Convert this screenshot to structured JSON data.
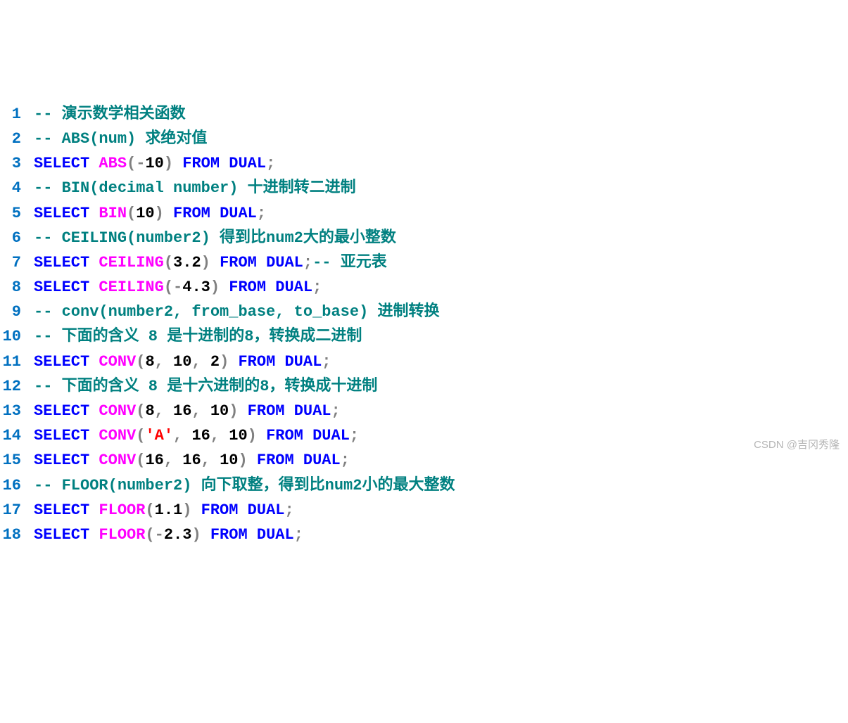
{
  "watermark": "CSDN @吉冈秀隆",
  "lines": [
    {
      "n": "1",
      "tokens": [
        {
          "c": "comment",
          "t": "-- 演示数学相关函数"
        }
      ]
    },
    {
      "n": "2",
      "tokens": [
        {
          "c": "comment",
          "t": "-- ABS(num) 求绝对值"
        }
      ]
    },
    {
      "n": "3",
      "tokens": [
        {
          "c": "keyword",
          "t": "SELECT"
        },
        {
          "c": "",
          "t": " "
        },
        {
          "c": "func",
          "t": "ABS"
        },
        {
          "c": "sym",
          "t": "("
        },
        {
          "c": "sym",
          "t": "-"
        },
        {
          "c": "num",
          "t": "10"
        },
        {
          "c": "sym",
          "t": ")"
        },
        {
          "c": "",
          "t": " "
        },
        {
          "c": "keyword",
          "t": "FROM"
        },
        {
          "c": "",
          "t": " "
        },
        {
          "c": "keyword",
          "t": "DUAL"
        },
        {
          "c": "sym",
          "t": ";"
        }
      ]
    },
    {
      "n": "4",
      "tokens": [
        {
          "c": "comment",
          "t": "-- BIN(decimal number) 十进制转二进制"
        }
      ]
    },
    {
      "n": "5",
      "tokens": [
        {
          "c": "keyword",
          "t": "SELECT"
        },
        {
          "c": "",
          "t": " "
        },
        {
          "c": "func",
          "t": "BIN"
        },
        {
          "c": "sym",
          "t": "("
        },
        {
          "c": "num",
          "t": "10"
        },
        {
          "c": "sym",
          "t": ")"
        },
        {
          "c": "",
          "t": " "
        },
        {
          "c": "keyword",
          "t": "FROM"
        },
        {
          "c": "",
          "t": " "
        },
        {
          "c": "keyword",
          "t": "DUAL"
        },
        {
          "c": "sym",
          "t": ";"
        }
      ]
    },
    {
      "n": "6",
      "tokens": [
        {
          "c": "comment",
          "t": "-- CEILING(number2) 得到比num2大的最小整数"
        }
      ]
    },
    {
      "n": "7",
      "tokens": [
        {
          "c": "keyword",
          "t": "SELECT"
        },
        {
          "c": "",
          "t": " "
        },
        {
          "c": "func",
          "t": "CEILING"
        },
        {
          "c": "sym",
          "t": "("
        },
        {
          "c": "num",
          "t": "3.2"
        },
        {
          "c": "sym",
          "t": ")"
        },
        {
          "c": "",
          "t": " "
        },
        {
          "c": "keyword",
          "t": "FROM"
        },
        {
          "c": "",
          "t": " "
        },
        {
          "c": "keyword",
          "t": "DUAL"
        },
        {
          "c": "sym",
          "t": ";"
        },
        {
          "c": "comment",
          "t": "-- 亚元表"
        }
      ]
    },
    {
      "n": "8",
      "tokens": [
        {
          "c": "keyword",
          "t": "SELECT"
        },
        {
          "c": "",
          "t": " "
        },
        {
          "c": "func",
          "t": "CEILING"
        },
        {
          "c": "sym",
          "t": "("
        },
        {
          "c": "sym",
          "t": "-"
        },
        {
          "c": "num",
          "t": "4.3"
        },
        {
          "c": "sym",
          "t": ")"
        },
        {
          "c": "",
          "t": " "
        },
        {
          "c": "keyword",
          "t": "FROM"
        },
        {
          "c": "",
          "t": " "
        },
        {
          "c": "keyword",
          "t": "DUAL"
        },
        {
          "c": "sym",
          "t": ";"
        }
      ]
    },
    {
      "n": "9",
      "tokens": [
        {
          "c": "comment",
          "t": "-- conv(number2, from_base, to_base) 进制转换"
        }
      ]
    },
    {
      "n": "10",
      "tokens": [
        {
          "c": "comment",
          "t": "-- 下面的含义 8 是十进制的8，转换成二进制"
        }
      ]
    },
    {
      "n": "11",
      "tokens": [
        {
          "c": "keyword",
          "t": "SELECT"
        },
        {
          "c": "",
          "t": " "
        },
        {
          "c": "func",
          "t": "CONV"
        },
        {
          "c": "sym",
          "t": "("
        },
        {
          "c": "num",
          "t": "8"
        },
        {
          "c": "sym",
          "t": ","
        },
        {
          "c": "",
          "t": " "
        },
        {
          "c": "num",
          "t": "10"
        },
        {
          "c": "sym",
          "t": ","
        },
        {
          "c": "",
          "t": " "
        },
        {
          "c": "num",
          "t": "2"
        },
        {
          "c": "sym",
          "t": ")"
        },
        {
          "c": "",
          "t": " "
        },
        {
          "c": "keyword",
          "t": "FROM"
        },
        {
          "c": "",
          "t": " "
        },
        {
          "c": "keyword",
          "t": "DUAL"
        },
        {
          "c": "sym",
          "t": ";"
        }
      ]
    },
    {
      "n": "12",
      "tokens": [
        {
          "c": "comment",
          "t": "-- 下面的含义 8 是十六进制的8，转换成十进制"
        }
      ]
    },
    {
      "n": "13",
      "tokens": [
        {
          "c": "keyword",
          "t": "SELECT"
        },
        {
          "c": "",
          "t": " "
        },
        {
          "c": "func",
          "t": "CONV"
        },
        {
          "c": "sym",
          "t": "("
        },
        {
          "c": "num",
          "t": "8"
        },
        {
          "c": "sym",
          "t": ","
        },
        {
          "c": "",
          "t": " "
        },
        {
          "c": "num",
          "t": "16"
        },
        {
          "c": "sym",
          "t": ","
        },
        {
          "c": "",
          "t": " "
        },
        {
          "c": "num",
          "t": "10"
        },
        {
          "c": "sym",
          "t": ")"
        },
        {
          "c": "",
          "t": " "
        },
        {
          "c": "keyword",
          "t": "FROM"
        },
        {
          "c": "",
          "t": " "
        },
        {
          "c": "keyword",
          "t": "DUAL"
        },
        {
          "c": "sym",
          "t": ";"
        }
      ]
    },
    {
      "n": "14",
      "tokens": [
        {
          "c": "keyword",
          "t": "SELECT"
        },
        {
          "c": "",
          "t": " "
        },
        {
          "c": "func",
          "t": "CONV"
        },
        {
          "c": "sym",
          "t": "("
        },
        {
          "c": "str",
          "t": "'A'"
        },
        {
          "c": "sym",
          "t": ","
        },
        {
          "c": "",
          "t": " "
        },
        {
          "c": "num",
          "t": "16"
        },
        {
          "c": "sym",
          "t": ","
        },
        {
          "c": "",
          "t": " "
        },
        {
          "c": "num",
          "t": "10"
        },
        {
          "c": "sym",
          "t": ")"
        },
        {
          "c": "",
          "t": " "
        },
        {
          "c": "keyword",
          "t": "FROM"
        },
        {
          "c": "",
          "t": " "
        },
        {
          "c": "keyword",
          "t": "DUAL"
        },
        {
          "c": "sym",
          "t": ";"
        }
      ]
    },
    {
      "n": "15",
      "tokens": [
        {
          "c": "keyword",
          "t": "SELECT"
        },
        {
          "c": "",
          "t": " "
        },
        {
          "c": "func",
          "t": "CONV"
        },
        {
          "c": "sym",
          "t": "("
        },
        {
          "c": "num",
          "t": "16"
        },
        {
          "c": "sym",
          "t": ","
        },
        {
          "c": "",
          "t": " "
        },
        {
          "c": "num",
          "t": "16"
        },
        {
          "c": "sym",
          "t": ","
        },
        {
          "c": "",
          "t": " "
        },
        {
          "c": "num",
          "t": "10"
        },
        {
          "c": "sym",
          "t": ")"
        },
        {
          "c": "",
          "t": " "
        },
        {
          "c": "keyword",
          "t": "FROM"
        },
        {
          "c": "",
          "t": " "
        },
        {
          "c": "keyword",
          "t": "DUAL"
        },
        {
          "c": "sym",
          "t": ";"
        }
      ]
    },
    {
      "n": "16",
      "tokens": [
        {
          "c": "comment",
          "t": "-- FLOOR(number2) 向下取整，得到比num2小的最大整数"
        }
      ]
    },
    {
      "n": "17",
      "tokens": [
        {
          "c": "keyword",
          "t": "SELECT"
        },
        {
          "c": "",
          "t": " "
        },
        {
          "c": "func",
          "t": "FLOOR"
        },
        {
          "c": "sym",
          "t": "("
        },
        {
          "c": "num",
          "t": "1.1"
        },
        {
          "c": "sym",
          "t": ")"
        },
        {
          "c": "",
          "t": " "
        },
        {
          "c": "keyword",
          "t": "FROM"
        },
        {
          "c": "",
          "t": " "
        },
        {
          "c": "keyword",
          "t": "DUAL"
        },
        {
          "c": "sym",
          "t": ";"
        }
      ]
    },
    {
      "n": "18",
      "tokens": [
        {
          "c": "keyword",
          "t": "SELECT"
        },
        {
          "c": "",
          "t": " "
        },
        {
          "c": "func",
          "t": "FLOOR"
        },
        {
          "c": "sym",
          "t": "("
        },
        {
          "c": "sym",
          "t": "-"
        },
        {
          "c": "num",
          "t": "2.3"
        },
        {
          "c": "sym",
          "t": ")"
        },
        {
          "c": "",
          "t": " "
        },
        {
          "c": "keyword",
          "t": "FROM"
        },
        {
          "c": "",
          "t": " "
        },
        {
          "c": "keyword",
          "t": "DUAL"
        },
        {
          "c": "sym",
          "t": ";"
        }
      ]
    }
  ]
}
